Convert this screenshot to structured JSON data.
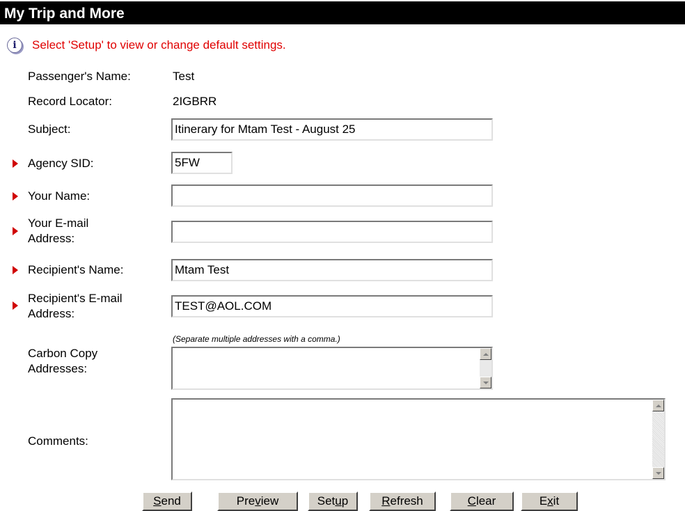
{
  "page_title": "My Trip and More",
  "info_message": "Select 'Setup' to view or change default settings.",
  "passenger": {
    "label": "Passenger's Name:",
    "value": "Test"
  },
  "record_locator": {
    "label": "Record Locator:",
    "value": "2IGBRR"
  },
  "subject": {
    "label": "Subject:",
    "value": "Itinerary for Mtam Test - August 25"
  },
  "agency_sid": {
    "label": "Agency SID:",
    "value": "5FW"
  },
  "your_name": {
    "label": "Your Name:",
    "value": ""
  },
  "your_email": {
    "label_line1": "Your E-mail",
    "label_line2": "Address:",
    "value": ""
  },
  "recipient_name": {
    "label": "Recipient's Name:",
    "value": "Mtam Test"
  },
  "recipient_email": {
    "label_line1": "Recipient's E-mail",
    "label_line2": "Address:",
    "value": "TEST@AOL.COM"
  },
  "cc": {
    "hint": "(Separate multiple addresses with a comma.)",
    "label_line1": "Carbon Copy",
    "label_line2": "Addresses:",
    "value": ""
  },
  "comments": {
    "label": "Comments:",
    "value": ""
  },
  "buttons": {
    "send": {
      "accel": "S",
      "rest": "end"
    },
    "preview": {
      "pre": "Pre",
      "accel": "v",
      "rest": "iew"
    },
    "setup": {
      "pre": "Set",
      "accel": "u",
      "rest": "p"
    },
    "refresh": {
      "accel": "R",
      "rest": "efresh"
    },
    "clear": {
      "accel": "C",
      "rest": "lear"
    },
    "exit": {
      "pre": "E",
      "accel": "x",
      "rest": "it"
    }
  },
  "colors": {
    "required_marker": "#d00000",
    "info_text": "#e00000"
  }
}
